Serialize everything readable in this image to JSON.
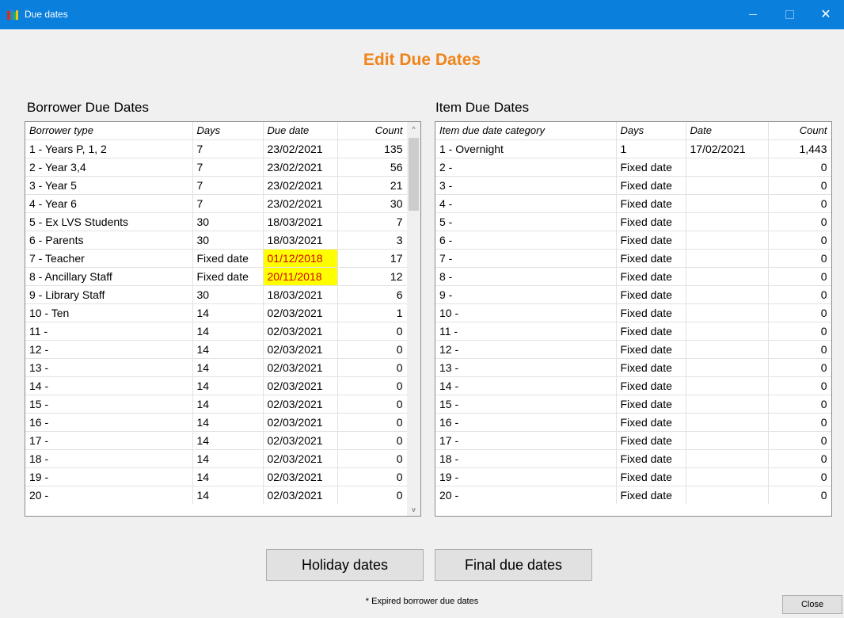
{
  "window": {
    "title": "Due dates",
    "minimize_glyph": "",
    "maximize_glyph": "",
    "close_glyph": "✕"
  },
  "page": {
    "title": "Edit Due Dates"
  },
  "borrower_section": {
    "heading": "Borrower Due Dates",
    "columns": [
      "Borrower type",
      "Days",
      "Due date",
      "Count"
    ],
    "rows": [
      {
        "type": "1 - Years P, 1, 2",
        "days": "7",
        "due": "23/02/2021",
        "count": "135",
        "expired": false
      },
      {
        "type": "2 - Year 3,4",
        "days": "7",
        "due": "23/02/2021",
        "count": "56",
        "expired": false
      },
      {
        "type": "3 - Year 5",
        "days": "7",
        "due": "23/02/2021",
        "count": "21",
        "expired": false
      },
      {
        "type": "4 - Year 6",
        "days": "7",
        "due": "23/02/2021",
        "count": "30",
        "expired": false
      },
      {
        "type": "5 - Ex LVS Students",
        "days": "30",
        "due": "18/03/2021",
        "count": "7",
        "expired": false
      },
      {
        "type": "6 - Parents",
        "days": "30",
        "due": "18/03/2021",
        "count": "3",
        "expired": false
      },
      {
        "type": "7 - Teacher",
        "days": "Fixed date",
        "due": "01/12/2018",
        "count": "17",
        "expired": true
      },
      {
        "type": "8 - Ancillary Staff",
        "days": "Fixed date",
        "due": "20/11/2018",
        "count": "12",
        "expired": true
      },
      {
        "type": "9 - Library Staff",
        "days": "30",
        "due": "18/03/2021",
        "count": "6",
        "expired": false
      },
      {
        "type": "10 - Ten",
        "days": "14",
        "due": "02/03/2021",
        "count": "1",
        "expired": false
      },
      {
        "type": "11 -",
        "days": "14",
        "due": "02/03/2021",
        "count": "0",
        "expired": false
      },
      {
        "type": "12 -",
        "days": "14",
        "due": "02/03/2021",
        "count": "0",
        "expired": false
      },
      {
        "type": "13 -",
        "days": "14",
        "due": "02/03/2021",
        "count": "0",
        "expired": false
      },
      {
        "type": "14 -",
        "days": "14",
        "due": "02/03/2021",
        "count": "0",
        "expired": false
      },
      {
        "type": "15 -",
        "days": "14",
        "due": "02/03/2021",
        "count": "0",
        "expired": false
      },
      {
        "type": "16 -",
        "days": "14",
        "due": "02/03/2021",
        "count": "0",
        "expired": false
      },
      {
        "type": "17 -",
        "days": "14",
        "due": "02/03/2021",
        "count": "0",
        "expired": false
      },
      {
        "type": "18 -",
        "days": "14",
        "due": "02/03/2021",
        "count": "0",
        "expired": false
      },
      {
        "type": "19 -",
        "days": "14",
        "due": "02/03/2021",
        "count": "0",
        "expired": false
      },
      {
        "type": "20 -",
        "days": "14",
        "due": "02/03/2021",
        "count": "0",
        "expired": false
      }
    ]
  },
  "item_section": {
    "heading": "Item Due Dates",
    "columns": [
      "Item due date category",
      "Days",
      "Date",
      "Count"
    ],
    "rows": [
      {
        "category": "1 - Overnight",
        "days": "1",
        "date": "17/02/2021",
        "count": "1,443"
      },
      {
        "category": "2 -",
        "days": "Fixed date",
        "date": "",
        "count": "0"
      },
      {
        "category": "3 -",
        "days": "Fixed date",
        "date": "",
        "count": "0"
      },
      {
        "category": "4 -",
        "days": "Fixed date",
        "date": "",
        "count": "0"
      },
      {
        "category": "5 -",
        "days": "Fixed date",
        "date": "",
        "count": "0"
      },
      {
        "category": "6 -",
        "days": "Fixed date",
        "date": "",
        "count": "0"
      },
      {
        "category": "7 -",
        "days": "Fixed date",
        "date": "",
        "count": "0"
      },
      {
        "category": "8 -",
        "days": "Fixed date",
        "date": "",
        "count": "0"
      },
      {
        "category": "9 -",
        "days": "Fixed date",
        "date": "",
        "count": "0"
      },
      {
        "category": "10 -",
        "days": "Fixed date",
        "date": "",
        "count": "0"
      },
      {
        "category": "11 -",
        "days": "Fixed date",
        "date": "",
        "count": "0"
      },
      {
        "category": "12 -",
        "days": "Fixed date",
        "date": "",
        "count": "0"
      },
      {
        "category": "13 -",
        "days": "Fixed date",
        "date": "",
        "count": "0"
      },
      {
        "category": "14 -",
        "days": "Fixed date",
        "date": "",
        "count": "0"
      },
      {
        "category": "15 -",
        "days": "Fixed date",
        "date": "",
        "count": "0"
      },
      {
        "category": "16 -",
        "days": "Fixed date",
        "date": "",
        "count": "0"
      },
      {
        "category": "17 -",
        "days": "Fixed date",
        "date": "",
        "count": "0"
      },
      {
        "category": "18 -",
        "days": "Fixed date",
        "date": "",
        "count": "0"
      },
      {
        "category": "19 -",
        "days": "Fixed date",
        "date": "",
        "count": "0"
      },
      {
        "category": "20 -",
        "days": "Fixed date",
        "date": "",
        "count": "0"
      }
    ]
  },
  "buttons": {
    "holiday": "Holiday dates",
    "final": "Final due dates",
    "close": "Close"
  },
  "footnote": "* Expired borrower due dates",
  "scrollbar": {
    "up_glyph": "^",
    "down_glyph": "v"
  },
  "colors": {
    "titlebar": "#0a7fdc",
    "page_title": "#f0841a",
    "expired_bg": "#ffff00",
    "expired_text": "#d40000"
  },
  "icons": {
    "app": "books-app-icon",
    "scroll_up": "chevron-up-icon",
    "scroll_down": "chevron-down-icon"
  }
}
